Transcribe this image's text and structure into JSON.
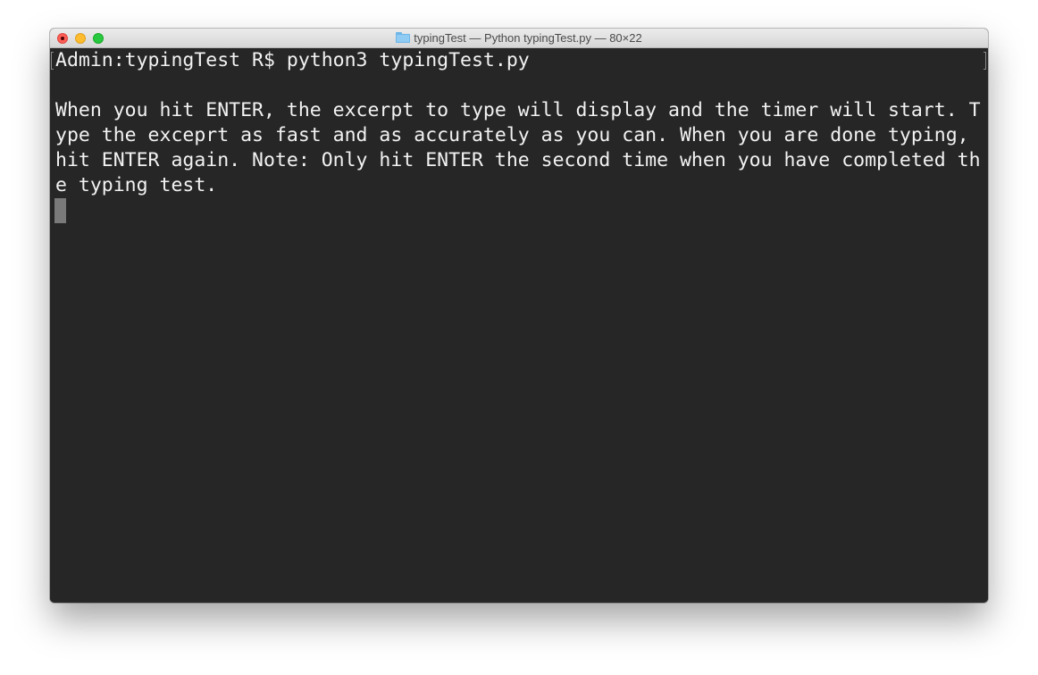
{
  "window": {
    "title": "typingTest — Python typingTest.py — 80×22",
    "folder_icon": "folder-icon"
  },
  "colors": {
    "close": "#fe5f57",
    "minimize": "#febc2e",
    "zoom": "#28c840",
    "terminal_bg": "#262626",
    "terminal_fg": "#f2f2f2"
  },
  "terminal": {
    "lines": [
      "Admin:typingTest R$ python3 typingTest.py",
      "",
      "When you hit ENTER, the excerpt to type will display and the timer will start. T",
      "ype the exceprt as fast and as accurately as you can. When you are done typing,",
      "hit ENTER again. Note: Only hit ENTER the second time when you have completed th",
      "e typing test."
    ]
  }
}
